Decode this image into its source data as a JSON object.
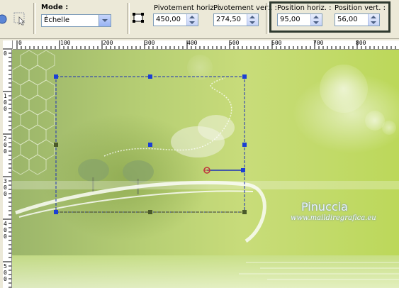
{
  "toolbar": {
    "mode": {
      "label": "Mode :",
      "value": "Échelle"
    },
    "pivot_h": {
      "label": "Pivotement horiz. :",
      "value": "450,00"
    },
    "pivot_v": {
      "label": "Pivotement vert. :",
      "value": "274,50"
    },
    "pos_h": {
      "label": "Position horiz. :",
      "value": "95,00"
    },
    "pos_v": {
      "label": "Position vert. :",
      "value": "56,00"
    }
  },
  "ruler": {
    "h_ticks": [
      "0",
      "100",
      "200",
      "300",
      "400",
      "500",
      "600",
      "700",
      "800"
    ],
    "v_ticks": [
      "0",
      "1\n0\n0",
      "2\n0\n0",
      "3\n0\n0",
      "4\n0\n0",
      "5\n0\n0"
    ]
  },
  "canvas": {
    "watermark_name": "Pinuccia",
    "watermark_url": "www.maildiregrafica.eu"
  },
  "colors": {
    "toolbar_bg": "#ece9d8",
    "handle": "#1b3fd4",
    "highlight_box": "#2f3a2f"
  }
}
